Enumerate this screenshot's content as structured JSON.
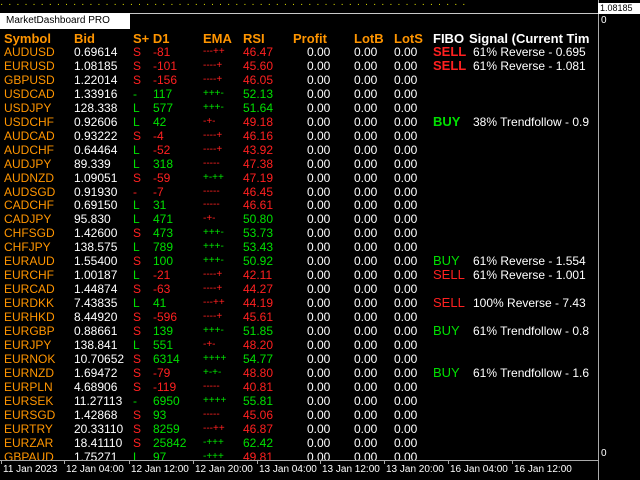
{
  "top_strip": "· · · · · · · · · · · · · · · · · · · · · · · · · · · · · · · · · · · · · · · · · · · · · · · · · · · · · · · · · ·",
  "window_title": "MarketDashboard PRO",
  "price_scale": {
    "current": "1.08185",
    "top": "0",
    "bottom": "0"
  },
  "columns": {
    "symbol": "Symbol",
    "bid": "Bid",
    "sd1": "S+ D1",
    "ema": "EMA",
    "rsi": "RSI",
    "profit": "Profit",
    "lotb": "LotB",
    "lots": "LotS",
    "fibo": "FIBO",
    "signal": "Signal (Current Tim"
  },
  "colors": {
    "symbol": "#ff9500",
    "buy": "#00e000",
    "sell": "#ff2020",
    "text": "#ffffff",
    "background": "#000000"
  },
  "rows": [
    {
      "symbol": "AUDUSD",
      "bid": "0.69614",
      "dir": "S",
      "d1": "-81",
      "ema": "---++",
      "rsi": "46.47",
      "profit": "0.00",
      "lotb": "0.00",
      "lots": "0.00",
      "fibo": "SELL",
      "signal": "61% Reverse - 0.695",
      "fibo_bold": true
    },
    {
      "symbol": "EURUSD",
      "bid": "1.08185",
      "dir": "S",
      "d1": "-101",
      "ema": "----+",
      "rsi": "45.60",
      "profit": "0.00",
      "lotb": "0.00",
      "lots": "0.00",
      "fibo": "SELL",
      "signal": "61% Reverse - 1.081",
      "fibo_bold": true
    },
    {
      "symbol": "GBPUSD",
      "bid": "1.22014",
      "dir": "S",
      "d1": "-156",
      "ema": "----+",
      "rsi": "46.05",
      "profit": "0.00",
      "lotb": "0.00",
      "lots": "0.00",
      "fibo": "",
      "signal": ""
    },
    {
      "symbol": "USDCAD",
      "bid": "1.33916",
      "dir": "-",
      "d1": "117",
      "ema": "+++-",
      "rsi": "52.13",
      "profit": "0.00",
      "lotb": "0.00",
      "lots": "0.00",
      "fibo": "",
      "signal": ""
    },
    {
      "symbol": "USDJPY",
      "bid": "128.338",
      "dir": "L",
      "d1": "577",
      "ema": "+++-",
      "rsi": "51.64",
      "profit": "0.00",
      "lotb": "0.00",
      "lots": "0.00",
      "fibo": "",
      "signal": ""
    },
    {
      "symbol": "USDCHF",
      "bid": "0.92606",
      "dir": "L",
      "d1": "42",
      "ema": "-+-",
      "rsi": "49.18",
      "profit": "0.00",
      "lotb": "0.00",
      "lots": "0.00",
      "fibo": "BUY",
      "signal": "38% Trendfollow - 0.9",
      "fibo_bold": true
    },
    {
      "symbol": "AUDCAD",
      "bid": "0.93222",
      "dir": "S",
      "d1": "-4",
      "ema": "----+",
      "rsi": "46.16",
      "profit": "0.00",
      "lotb": "0.00",
      "lots": "0.00",
      "fibo": "",
      "signal": ""
    },
    {
      "symbol": "AUDCHF",
      "bid": "0.64464",
      "dir": "L",
      "d1": "-52",
      "ema": "----+",
      "rsi": "43.92",
      "profit": "0.00",
      "lotb": "0.00",
      "lots": "0.00",
      "fibo": "",
      "signal": ""
    },
    {
      "symbol": "AUDJPY",
      "bid": "89.339",
      "dir": "L",
      "d1": "318",
      "ema": "-----",
      "rsi": "47.38",
      "profit": "0.00",
      "lotb": "0.00",
      "lots": "0.00",
      "fibo": "",
      "signal": ""
    },
    {
      "symbol": "AUDNZD",
      "bid": "1.09051",
      "dir": "S",
      "d1": "-59",
      "ema": "+-++",
      "rsi": "47.19",
      "profit": "0.00",
      "lotb": "0.00",
      "lots": "0.00",
      "fibo": "",
      "signal": ""
    },
    {
      "symbol": "AUDSGD",
      "bid": "0.91930",
      "dir": "-",
      "d1": "-7",
      "ema": "-----",
      "rsi": "46.45",
      "profit": "0.00",
      "lotb": "0.00",
      "lots": "0.00",
      "fibo": "",
      "signal": ""
    },
    {
      "symbol": "CADCHF",
      "bid": "0.69150",
      "dir": "L",
      "d1": "31",
      "ema": "-----",
      "rsi": "46.61",
      "profit": "0.00",
      "lotb": "0.00",
      "lots": "0.00",
      "fibo": "",
      "signal": ""
    },
    {
      "symbol": "CADJPY",
      "bid": "95.830",
      "dir": "L",
      "d1": "471",
      "ema": "-+-",
      "rsi": "50.80",
      "profit": "0.00",
      "lotb": "0.00",
      "lots": "0.00",
      "fibo": "",
      "signal": ""
    },
    {
      "symbol": "CHFSGD",
      "bid": "1.42600",
      "dir": "S",
      "d1": "473",
      "ema": "+++-",
      "rsi": "53.73",
      "profit": "0.00",
      "lotb": "0.00",
      "lots": "0.00",
      "fibo": "",
      "signal": ""
    },
    {
      "symbol": "CHFJPY",
      "bid": "138.575",
      "dir": "L",
      "d1": "789",
      "ema": "+++-",
      "rsi": "53.43",
      "profit": "0.00",
      "lotb": "0.00",
      "lots": "0.00",
      "fibo": "",
      "signal": ""
    },
    {
      "symbol": "EURAUD",
      "bid": "1.55400",
      "dir": "S",
      "d1": "100",
      "ema": "+++-",
      "rsi": "50.92",
      "profit": "0.00",
      "lotb": "0.00",
      "lots": "0.00",
      "fibo": "BUY",
      "signal": "61% Reverse - 1.554"
    },
    {
      "symbol": "EURCHF",
      "bid": "1.00187",
      "dir": "L",
      "d1": "-21",
      "ema": "----+",
      "rsi": "42.11",
      "profit": "0.00",
      "lotb": "0.00",
      "lots": "0.00",
      "fibo": "SELL",
      "signal": "61% Reverse - 1.001"
    },
    {
      "symbol": "EURCAD",
      "bid": "1.44874",
      "dir": "S",
      "d1": "-63",
      "ema": "----+",
      "rsi": "44.27",
      "profit": "0.00",
      "lotb": "0.00",
      "lots": "0.00",
      "fibo": "",
      "signal": ""
    },
    {
      "symbol": "EURDKK",
      "bid": "7.43835",
      "dir": "L",
      "d1": "41",
      "ema": "---++",
      "rsi": "44.19",
      "profit": "0.00",
      "lotb": "0.00",
      "lots": "0.00",
      "fibo": "SELL",
      "signal": "100% Reverse - 7.43"
    },
    {
      "symbol": "EURHKD",
      "bid": "8.44920",
      "dir": "S",
      "d1": "-596",
      "ema": "----+",
      "rsi": "45.61",
      "profit": "0.00",
      "lotb": "0.00",
      "lots": "0.00",
      "fibo": "",
      "signal": ""
    },
    {
      "symbol": "EURGBP",
      "bid": "0.88661",
      "dir": "S",
      "d1": "139",
      "ema": "+++-",
      "rsi": "51.85",
      "profit": "0.00",
      "lotb": "0.00",
      "lots": "0.00",
      "fibo": "BUY",
      "signal": "61% Trendfollow - 0.8"
    },
    {
      "symbol": "EURJPY",
      "bid": "138.841",
      "dir": "L",
      "d1": "551",
      "ema": "-+-",
      "rsi": "48.20",
      "profit": "0.00",
      "lotb": "0.00",
      "lots": "0.00",
      "fibo": "",
      "signal": ""
    },
    {
      "symbol": "EURNOK",
      "bid": "10.70652",
      "dir": "S",
      "d1": "6314",
      "ema": "++++",
      "rsi": "54.77",
      "profit": "0.00",
      "lotb": "0.00",
      "lots": "0.00",
      "fibo": "",
      "signal": ""
    },
    {
      "symbol": "EURNZD",
      "bid": "1.69472",
      "dir": "S",
      "d1": "-79",
      "ema": "+-+-",
      "rsi": "48.80",
      "profit": "0.00",
      "lotb": "0.00",
      "lots": "0.00",
      "fibo": "BUY",
      "signal": "61% Trendfollow - 1.6"
    },
    {
      "symbol": "EURPLN",
      "bid": "4.68906",
      "dir": "S",
      "d1": "-119",
      "ema": "-----",
      "rsi": "40.81",
      "profit": "0.00",
      "lotb": "0.00",
      "lots": "0.00",
      "fibo": "",
      "signal": ""
    },
    {
      "symbol": "EURSEK",
      "bid": "11.27113",
      "dir": "-",
      "d1": "6950",
      "ema": "++++",
      "rsi": "55.81",
      "profit": "0.00",
      "lotb": "0.00",
      "lots": "0.00",
      "fibo": "",
      "signal": ""
    },
    {
      "symbol": "EURSGD",
      "bid": "1.42868",
      "dir": "S",
      "d1": "93",
      "ema": "-----",
      "rsi": "45.06",
      "profit": "0.00",
      "lotb": "0.00",
      "lots": "0.00",
      "fibo": "",
      "signal": ""
    },
    {
      "symbol": "EURTRY",
      "bid": "20.33110",
      "dir": "S",
      "d1": "8259",
      "ema": "---++",
      "rsi": "46.87",
      "profit": "0.00",
      "lotb": "0.00",
      "lots": "0.00",
      "fibo": "",
      "signal": ""
    },
    {
      "symbol": "EURZAR",
      "bid": "18.41110",
      "dir": "S",
      "d1": "25842",
      "ema": "-+++",
      "rsi": "62.42",
      "profit": "0.00",
      "lotb": "0.00",
      "lots": "0.00",
      "fibo": "",
      "signal": ""
    },
    {
      "symbol": "GBPAUD",
      "bid": "1.75271",
      "dir": "L",
      "d1": "97",
      "ema": "-+++",
      "rsi": "49.81",
      "profit": "0.00",
      "lotb": "0.00",
      "lots": "0.00",
      "fibo": "",
      "signal": ""
    }
  ],
  "time_axis": [
    "11 Jan 2023",
    "12 Jan 04:00",
    "12 Jan 12:00",
    "12 Jan 20:00",
    "13 Jan 04:00",
    "13 Jan 12:00",
    "13 Jan 20:00",
    "16 Jan 04:00",
    "16 Jan 12:00"
  ]
}
